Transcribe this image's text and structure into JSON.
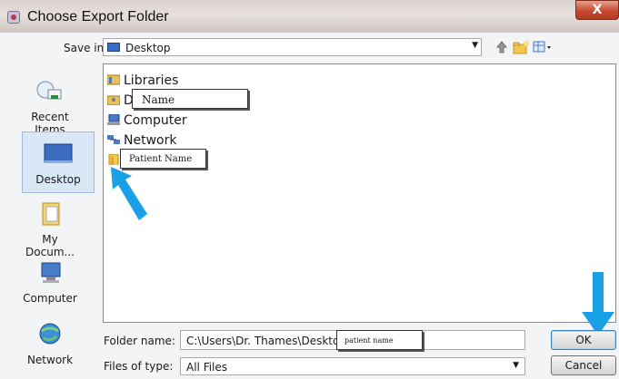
{
  "window": {
    "title": "Choose Export Folder",
    "close_glyph": "X"
  },
  "toolbar": {
    "save_in_label": "Save in:",
    "save_in_value": "Desktop",
    "icons": [
      "up-folder-icon",
      "new-folder-icon",
      "view-menu-icon"
    ]
  },
  "places": [
    {
      "label": "Recent Items",
      "icon": "recent-items-icon",
      "selected": false
    },
    {
      "label": "Desktop",
      "icon": "desktop-icon",
      "selected": true
    },
    {
      "label": "My Docum...",
      "icon": "my-documents-icon",
      "selected": false
    },
    {
      "label": "Computer",
      "icon": "computer-icon",
      "selected": false
    },
    {
      "label": "Network",
      "icon": "network-icon",
      "selected": false
    }
  ],
  "files": [
    {
      "label": "Libraries",
      "icon": "libraries-icon"
    },
    {
      "label": "D",
      "icon": "user-folder-icon"
    },
    {
      "label": "Computer",
      "icon": "computer-icon"
    },
    {
      "label": "Network",
      "icon": "network-icon"
    },
    {
      "label": "",
      "icon": "folder-icon"
    }
  ],
  "callouts": {
    "name": "Name",
    "patient_name": "Patient Name",
    "patient_name_field": "patient name"
  },
  "footer": {
    "folder_name_label": "Folder name:",
    "folder_name_value": "C:\\Users\\Dr. Thames\\Desktop",
    "files_of_type_label": "Files of type:",
    "files_of_type_value": "All Files",
    "ok_label": "OK",
    "cancel_label": "Cancel"
  },
  "colors": {
    "annotation_arrow": "#1aa0e6",
    "close_button": "#c6492f",
    "selection": "#d9e7f6"
  }
}
